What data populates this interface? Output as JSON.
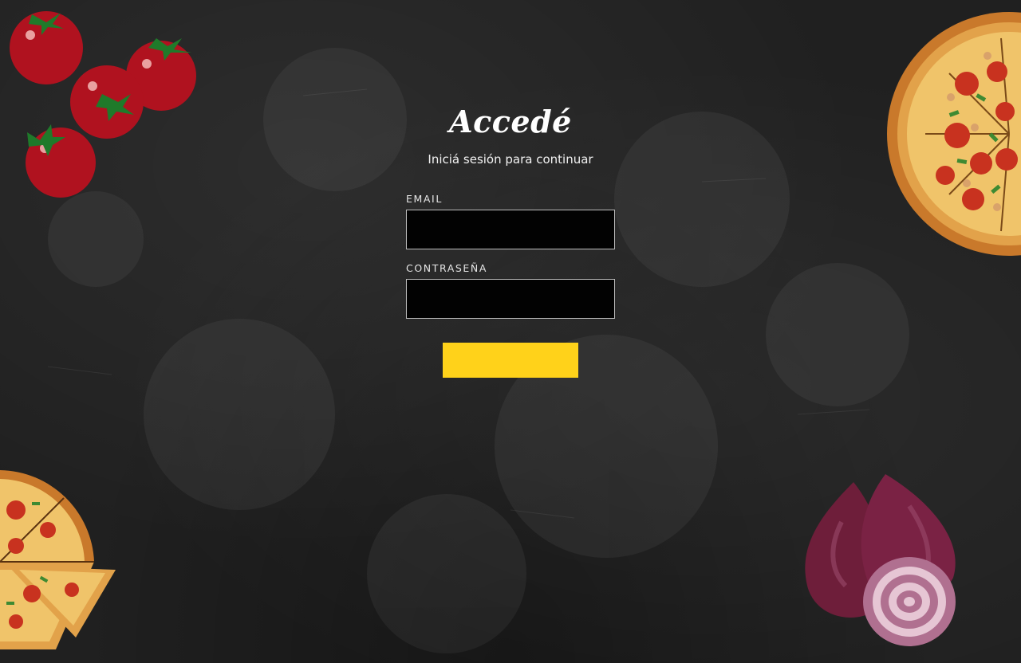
{
  "login": {
    "title": "Accedé",
    "subtitle": "Iniciá sesión para continuar",
    "email_label": "EMAIL",
    "email_value": "",
    "password_label": "CONTRASEÑA",
    "password_value": "",
    "submit_label": ""
  },
  "colors": {
    "background": "#202020",
    "input_background": "#020202",
    "input_border": "#bdbdbd",
    "button": "#ffd21a",
    "text": "#ffffff"
  },
  "decorations": [
    "tomatoes-illustration",
    "pizza-illustration",
    "pizza-slice-illustration",
    "red-onion-illustration"
  ]
}
